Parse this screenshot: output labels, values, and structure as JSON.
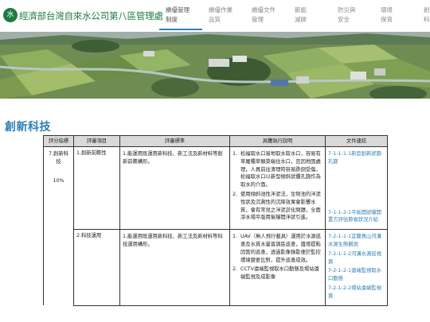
{
  "header": {
    "logo_icon": "water-drop-logo-icon",
    "logo_text": "水",
    "site_title": "經濟部台灣自來水公司第八區管理處",
    "nav": [
      {
        "line1": "績優管理",
        "line2": "制度",
        "active": true
      },
      {
        "line1": "績優作業",
        "line2": "品質",
        "active": false
      },
      {
        "line1": "績優文件",
        "line2": "管理",
        "active": false
      },
      {
        "line1": "節能",
        "line2": "減碳",
        "active": false
      },
      {
        "line1": "防災與",
        "line2": "安全",
        "active": false
      },
      {
        "line1": "環境",
        "line2": "保育",
        "active": false
      },
      {
        "line1": "創新",
        "line2": "科技",
        "active": false
      }
    ]
  },
  "page": {
    "title": "創新科技"
  },
  "table": {
    "headers": [
      "評分指標",
      "評審項目",
      "評審標準",
      "具體執行說明",
      "文件連結"
    ],
    "score": {
      "name": "7.創新科技",
      "percent": "10%"
    },
    "rows": [
      {
        "item": "1.創新前瞻性",
        "standard": "1.能運用既運用新科技、新工法及新材料等創新前瞻構形。",
        "exec": [
          {
            "num": "1.",
            "text": "松福取水口易地取水取水口，容易有草履種草類菜端住水口，且因地固處理，人員前往清理時容易跌倒受傷，松福取水口以新型傾斜狀攔孔篩作為取水的介面。"
          },
          {
            "num": "2.",
            "text": "使用傾斜池性泮泥法，生物池的泮泥性狀及沉澱性的沉降效果會影響水質，會有常見之泮泥淤化問題，全面淨水場平版用氣曝開泮狀引進。"
          }
        ],
        "links": [
          "7-1-1-1-1新型創新狀篩孔篩",
          "7-1-1-2-1平板開狀曝開置方評估節省狀況介紹"
        ]
      },
      {
        "item": "2.科技運用",
        "standard": "1.能運用既運用新科技、新工法及新材料等科技運用構形。",
        "exec": [
          {
            "num": "1.",
            "text": "UAV（無人飛行載具）運用於水源巡查及水質水量普調區巡查，護增提點因管的巡查，透過影像錄影便於監控環境變更比對，提升巡查成效。"
          },
          {
            "num": "2.",
            "text": "CCTV遠端監視取水口動態及場站遠端監視及成影像"
          }
        ],
        "links": [
          "7-2-1-1-1宜蘭員山河溝水源生態觀測",
          "7-2-1-1-2河溝水源巡視頁",
          "7-2-1-2-1遠端監視取水口動態",
          "7-2-1-2-2場站遠端監視頁"
        ]
      }
    ]
  }
}
